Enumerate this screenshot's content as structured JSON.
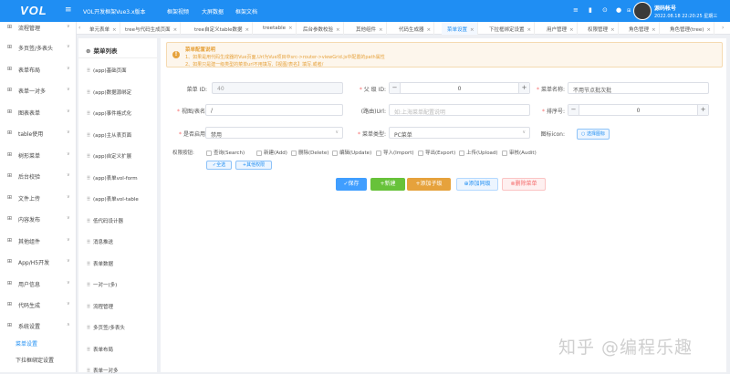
{
  "topbar": {
    "logo": "VOL",
    "menu_icon": "≡",
    "app_title": "VOL开发框架Vue3.x版本",
    "nav": [
      "框架视频",
      "大屏数据",
      "框架文档"
    ],
    "icons": [
      "≡",
      "▮",
      "⊙",
      "●",
      "⊞"
    ],
    "user_name": "源码帐号",
    "user_time": "2022.08.18 22:20:25 星期三",
    "colors": {
      "primary": "#1f8ef3"
    }
  },
  "sidebar": {
    "items": [
      {
        "icon": "⊞",
        "label": "流程管理",
        "chev": "∨"
      },
      {
        "icon": "⊞",
        "label": "多页签/多表头",
        "chev": "∨"
      },
      {
        "icon": "⊞",
        "label": "表单布局",
        "chev": "∨"
      },
      {
        "icon": "⊞",
        "label": "表单一对多",
        "chev": "∨"
      },
      {
        "icon": "⊞",
        "label": "图表表单",
        "chev": "∨"
      },
      {
        "icon": "⊞",
        "label": "table使用",
        "chev": "∨"
      },
      {
        "icon": "⊞",
        "label": "树形菜单",
        "chev": "∨"
      },
      {
        "icon": "⊞",
        "label": "后台校验",
        "chev": "∨"
      },
      {
        "icon": "⊞",
        "label": "文件上传",
        "chev": "∨"
      },
      {
        "icon": "⊞",
        "label": "内容发布",
        "chev": "∨"
      },
      {
        "icon": "⊞",
        "label": "其他组件",
        "chev": "∨"
      },
      {
        "icon": "⊞",
        "label": "App/H5开发",
        "chev": "∨"
      },
      {
        "icon": "⊞",
        "label": "用户信息",
        "chev": "∨"
      },
      {
        "icon": "⊞",
        "label": "代码生成",
        "chev": "∨"
      },
      {
        "icon": "⊞",
        "label": "系统设置",
        "chev": "∧"
      }
    ],
    "sub_items": [
      {
        "label": "菜单设置",
        "active": true
      },
      {
        "label": "下拉框绑定设置",
        "active": false
      }
    ]
  },
  "tabs": [
    {
      "label": "单元表单",
      "active": false
    },
    {
      "label": "tree与代码生成页面",
      "active": false
    },
    {
      "label": "tree自定义table数据",
      "active": false
    },
    {
      "label": "treetable",
      "active": false
    },
    {
      "label": "后台参数校验",
      "active": false
    },
    {
      "label": "其他组件",
      "active": false
    },
    {
      "label": "代码生成器",
      "active": false
    },
    {
      "label": "菜单设置",
      "active": true
    },
    {
      "label": "下拉框绑定设置",
      "active": false
    },
    {
      "label": "用户管理",
      "active": false
    },
    {
      "label": "权限管理",
      "active": false
    },
    {
      "label": "角色管理",
      "active": false
    },
    {
      "label": "角色管理(tree)",
      "active": false
    }
  ],
  "tab_close": "×",
  "tab_arrows": [
    "‹",
    "›"
  ],
  "menu_panel": {
    "title": "菜单列表",
    "title_icon": "⊛",
    "items": [
      "(app)基础页面",
      "(app)数据源绑定",
      "(app)事件格式化",
      "(app)主从表页面",
      "(app)自定义扩展",
      "(app)表单vol-form",
      "(app)表单vol-table",
      "低代码设计器",
      "消息推送",
      "表单数据",
      "一对一(多)",
      "流程管理",
      "多页签/多表头",
      "表单布局",
      "表单一对多"
    ]
  },
  "notice": {
    "icon": "!",
    "title": "菜单配置说明",
    "lines": [
      "1、如果是用代码生成器的Vue页面,Url为Vue项目中src->router->viewGrid.js中配置的path属性",
      "2、如果只是建一级类型的菜单url不用填写,【视图/表名】填写.或者/"
    ]
  },
  "form": {
    "menu_id_label": "菜单 ID:",
    "menu_id_value": "40",
    "parent_id_label": "父 级 ID:",
    "parent_id_value": "0",
    "menu_name_label": "菜单名称:",
    "menu_name_value": "不用节点批次批",
    "view_label": "视图/表名:",
    "view_value": "/",
    "route_label": "(路由)Url:",
    "route_placeholder": "如:上海菜单配置说明",
    "sort_label": "排序号:",
    "sort_value": "0",
    "enabled_label": "是否启用:",
    "enabled_value": "禁用",
    "menu_type_label": "菜单类型:",
    "menu_type_value": "PC菜单",
    "icon_label": "图标icon:",
    "icon_button": "选择图标",
    "perm_label": "权限按钮:",
    "permissions": [
      "查询(Search)",
      "新建(Add)",
      "删除(Delete)",
      "编辑(Update)",
      "导入(Import)",
      "导出(Export)",
      "上传(Upload)",
      "审核(Audit)"
    ],
    "select_all": "全选",
    "other_perm": "其他权限"
  },
  "actions": [
    {
      "label": "✓保存",
      "color": "#409eff"
    },
    {
      "label": "+新建",
      "color": "#67c23a"
    },
    {
      "label": "+添加子级",
      "color": "#e6a23c"
    },
    {
      "label": "⊕添加同级",
      "color": "#ecf5ff"
    },
    {
      "label": "⊗删除菜单",
      "color": "#fef0f0"
    }
  ],
  "watermark": "知乎 @编程乐趣"
}
